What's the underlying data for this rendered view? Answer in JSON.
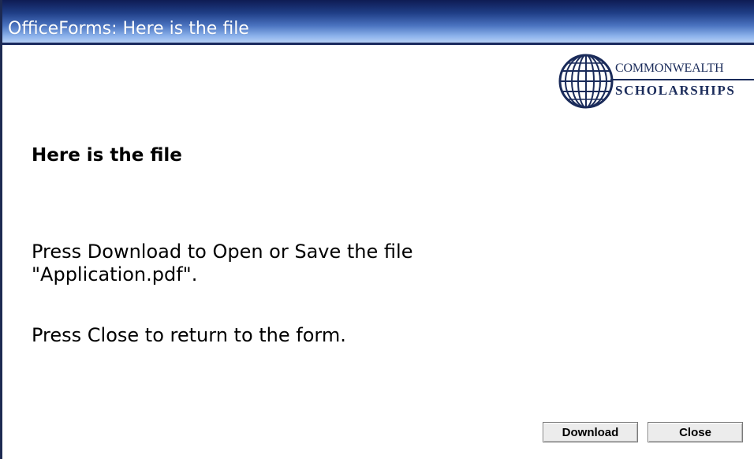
{
  "window": {
    "title": "OfficeForms: Here is the file"
  },
  "logo": {
    "line1": "COMMONWEALTH",
    "line2": "SCHOLARSHIPS"
  },
  "content": {
    "heading": "Here is the file",
    "message_line1": "Press Download to Open or Save the file",
    "message_line2": "\"Application.pdf\".",
    "message_close": "Press Close to return to the form."
  },
  "buttons": {
    "download_label": "Download",
    "close_label": "Close"
  },
  "colors": {
    "titlebar_dark": "#0e1c54",
    "titlebar_light": "#b6d0f4",
    "logo_navy": "#1a2b5a"
  }
}
